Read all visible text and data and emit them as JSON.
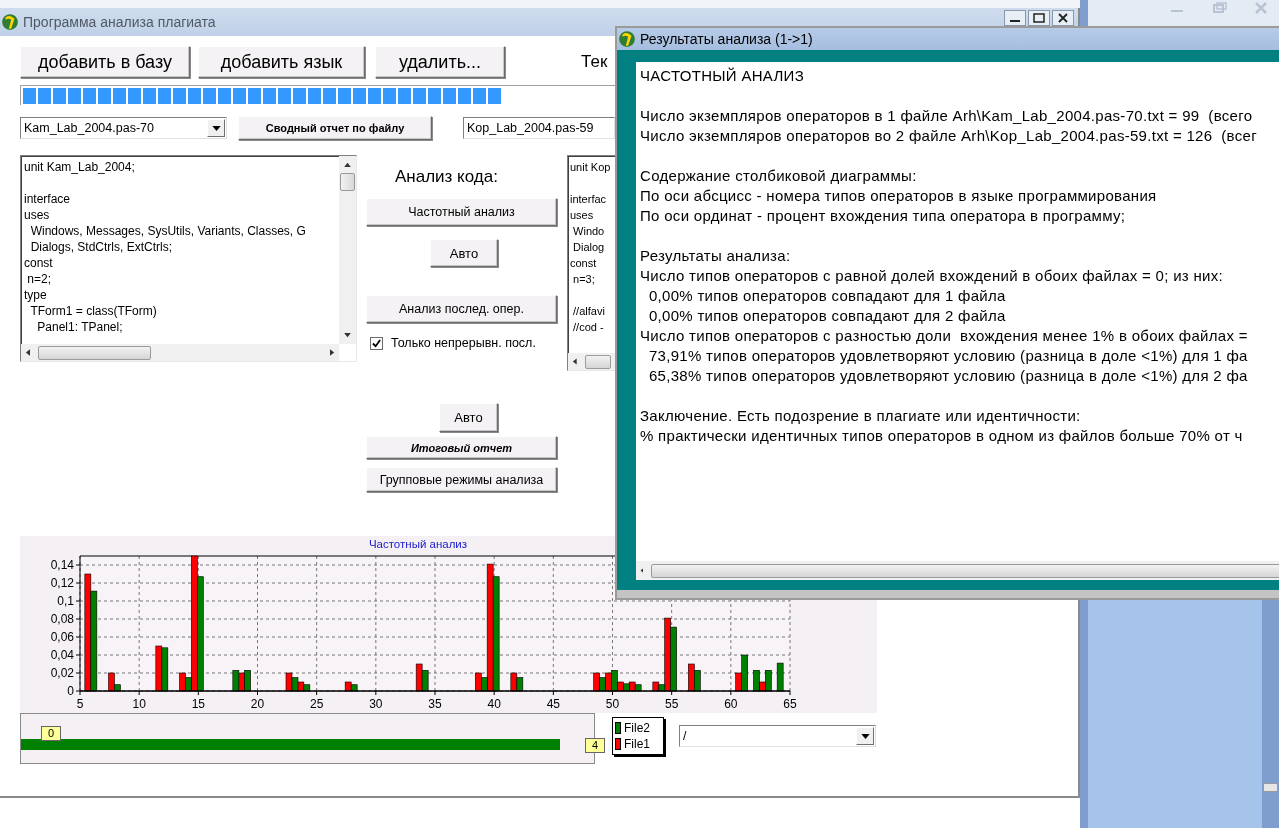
{
  "main_window": {
    "title": "Программа анализа плагиата",
    "toolbar_buttons": [
      "добавить в базу",
      "добавить язык",
      "удалить..."
    ],
    "text_label": "Тек",
    "progress": {
      "level": 0.81
    },
    "file1_combo": "Kam_Lab_2004.pas-70",
    "summary_button": "Сводный отчет по файлу",
    "file2_combo": "Kop_Lab_2004.pas-59",
    "code_left": [
      [
        "unit Kam_Lab_2004;"
      ],
      [
        "interface",
        "uses",
        "  Windows, Messages, SysUtils, Variants, Classes, G",
        "  Dialogs, StdCtrls, ExtCtrls;",
        "const",
        " n=2;",
        "type",
        "  TForm1 = class(TForm)",
        "    Panel1: TPanel;"
      ]
    ],
    "code_right": [
      [
        "unit Kop"
      ],
      [
        "interfac",
        "uses",
        " Windo",
        " Dialog",
        "const",
        " n=3;"
      ],
      [
        " //alfavi",
        " //cod -"
      ]
    ],
    "analysis": {
      "heading": "Анализ кода:",
      "frequency_button": "Частотный анализ",
      "auto_button_1": "Авто",
      "sequence_button": "Анализ послед. опер.",
      "continuous_checkbox": {
        "label": "Только непрерывн. посл.",
        "checked": true
      },
      "auto_button_2": "Авто",
      "final_report_button": "Итоговый отчет",
      "group_modes_button": "Групповые режимы анализа"
    },
    "chart": {
      "chart_data": {
        "type": "bar",
        "title": "Частотный анализ",
        "x": [
          6,
          8,
          12,
          14,
          15,
          18,
          19,
          23,
          24,
          28,
          34,
          39,
          40,
          42,
          49,
          50,
          51,
          52,
          54,
          55,
          57,
          61,
          62,
          63,
          64
        ],
        "series": [
          {
            "name": "File1",
            "color": "#ff0000",
            "values": [
              0.13,
              0.02,
              0.05,
              0.02,
              0.15,
              0,
              0.02,
              0.02,
              0.01,
              0.01,
              0.03,
              0.02,
              0.141,
              0.02,
              0.02,
              0.02,
              0.01,
              0.01,
              0.01,
              0.081,
              0.03,
              0.02,
              0,
              0.01,
              0
            ]
          },
          {
            "name": "File2",
            "color": "#008000",
            "values": [
              0.111,
              0.007,
              0.048,
              0.015,
              0.127,
              0.023,
              0.023,
              0.015,
              0.007,
              0.007,
              0.023,
              0.015,
              0.127,
              0.015,
              0.015,
              0.023,
              0.008,
              0.007,
              0.007,
              0.071,
              0.023,
              0.04,
              0.023,
              0.023,
              0.031
            ]
          }
        ],
        "grid": true,
        "xlim": [
          5,
          65
        ],
        "ylim": [
          0,
          0.15
        ],
        "xticks": [
          5,
          10,
          15,
          20,
          25,
          30,
          35,
          40,
          45,
          50,
          55,
          60,
          65
        ],
        "yticks": [
          {
            "value": 0,
            "label": "0"
          },
          {
            "value": 0.02,
            "label": "0,02"
          },
          {
            "value": 0.04,
            "label": "0,04"
          },
          {
            "value": 0.06,
            "label": "0,06"
          },
          {
            "value": 0.08,
            "label": "0,08"
          },
          {
            "value": 0.1,
            "label": "0,1"
          },
          {
            "value": 0.12,
            "label": "0,12"
          },
          {
            "value": 0.14,
            "label": "0,14"
          }
        ]
      }
    },
    "gauge": {
      "min_label": "0",
      "max_label": "4",
      "level": 0.94
    },
    "filter_combo": "/"
  },
  "results_window": {
    "title": "Результаты анализа (1->1)",
    "paragraphs": [
      [
        "ЧАСТОТНЫЙ АНАЛИЗ"
      ],
      [
        "Число экземпляров операторов в 1 файле Arh\\Kam_Lab_2004.pas-70.txt = 99  (всего",
        "Число экземпляров операторов во 2 файле Arh\\Kop_Lab_2004.pas-59.txt = 126  (всег"
      ],
      [
        "Содержание столбиковой диаграммы:",
        "По оси абсцисс - номера типов операторов в языке программирования",
        "По оси ординат - процент вхождения типа оператора в программу;"
      ],
      [
        "Результаты анализа:",
        "Число типов операторов с равной долей вхождений в обоих файлах = 0; из них:",
        "  0,00% типов операторов совпадают для 1 файла",
        "  0,00% типов операторов совпадают для 2 файла",
        "Число типов операторов с разностью доли  вхождения менее 1% в обоих файлах =",
        "  73,91% типов операторов удовлетворяют условию (разница в доле <1%) для 1 фа",
        "  65,38% типов операторов удовлетворяют условию (разница в доле <1%) для 2 фа"
      ],
      [
        "Заключение. Есть подозрение в плагиате или идентичности:",
        "% практически идентичных типов операторов в одном из файлов больше 70% от ч"
      ]
    ]
  }
}
